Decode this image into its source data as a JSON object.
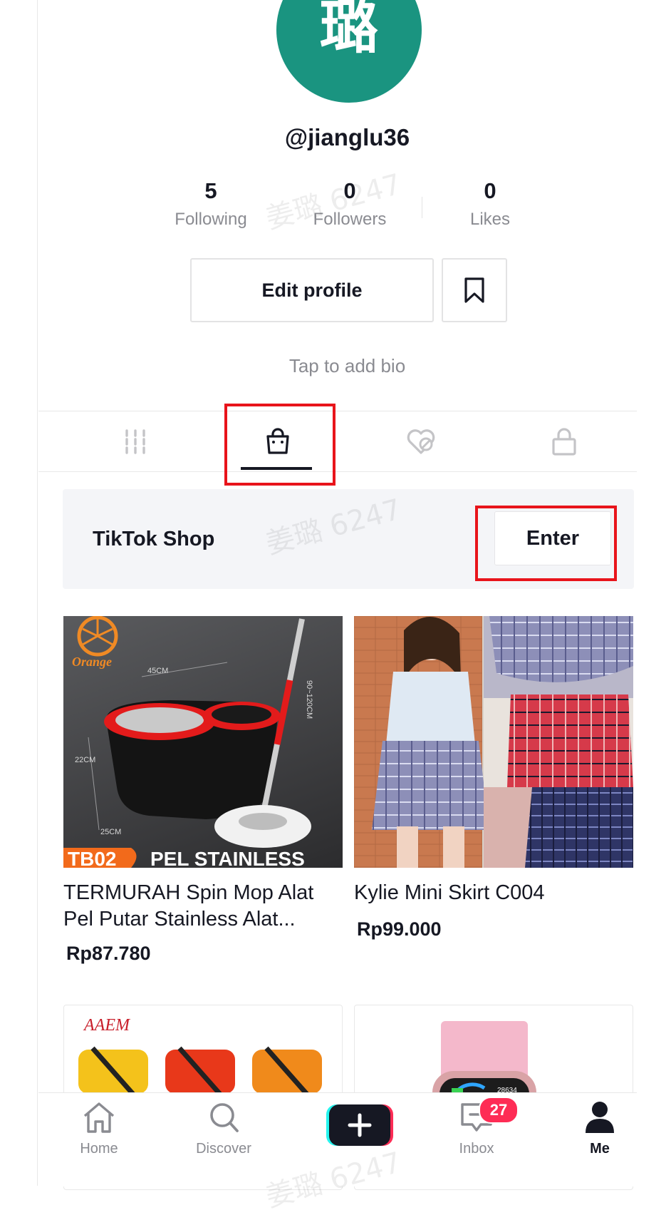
{
  "profile": {
    "avatar_char": "璐",
    "username": "@jianglu36",
    "stats": [
      {
        "value": "5",
        "label": "Following"
      },
      {
        "value": "0",
        "label": "Followers"
      },
      {
        "value": "0",
        "label": "Likes"
      }
    ],
    "edit_profile_label": "Edit profile",
    "bio_placeholder": "Tap to add bio"
  },
  "tabs": [
    "videos-grid",
    "shop",
    "liked",
    "private"
  ],
  "active_tab": "shop",
  "shop": {
    "title": "TikTok Shop",
    "enter_label": "Enter"
  },
  "products": [
    {
      "name": "TERMURAH Spin Mop Alat Pel Putar Stainless  Alat...",
      "price": "Rp87.780",
      "brand": "Orange",
      "img_texts": [
        "45CM",
        "22CM",
        "25CM",
        "90~120CM",
        "TB02",
        "PEL STAINLESS"
      ]
    },
    {
      "name": "Kylie Mini Skirt C004",
      "price": "Rp99.000"
    }
  ],
  "products_row2": [
    {
      "brand": "AAEM"
    },
    {
      "watch_text": "28634"
    }
  ],
  "watermark": "姜璐 6247",
  "nav": {
    "items": [
      "Home",
      "Discover",
      "",
      "Inbox",
      "Me"
    ],
    "inbox_badge": "27"
  },
  "colors": {
    "avatar_bg": "#1a9480",
    "highlight_red": "#e8141b",
    "badge": "#fe2c55",
    "create_cyan": "#25f4ee",
    "create_pink": "#fe2c55"
  }
}
